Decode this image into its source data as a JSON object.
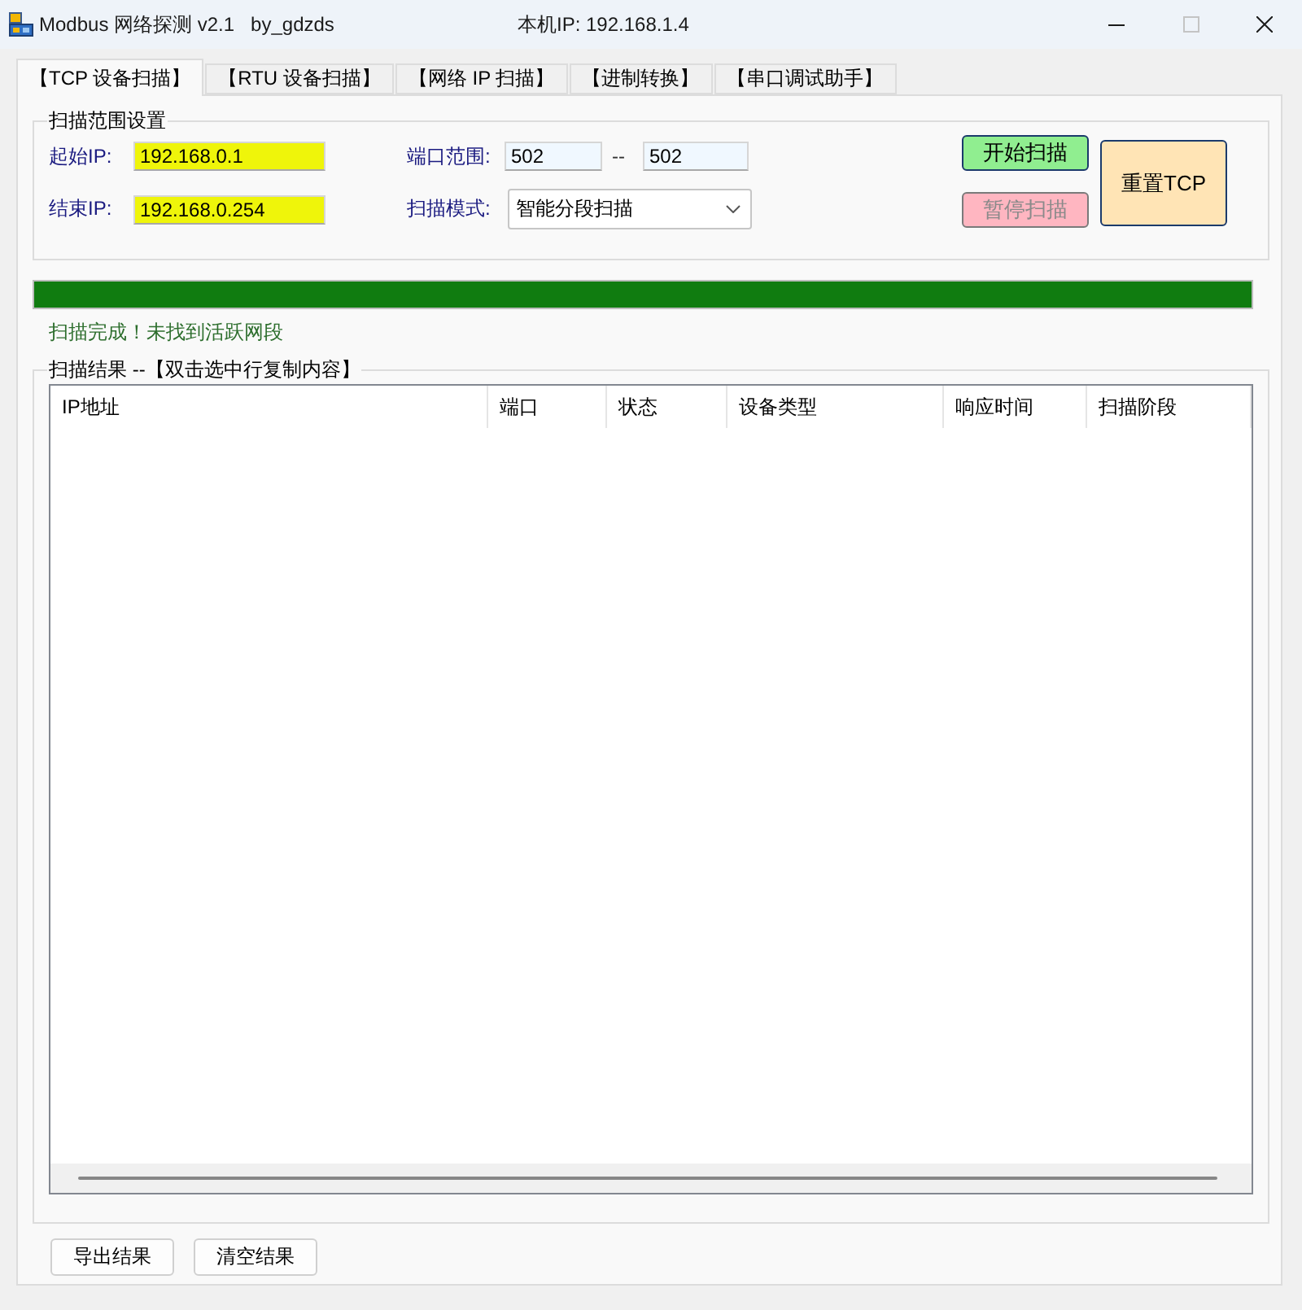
{
  "window": {
    "title": "Modbus 网络探测 v2.1   by_gdzds",
    "local_ip": "本机IP: 192.168.1.4",
    "maximize_disabled": true
  },
  "tabs": [
    {
      "label": "【TCP 设备扫描】",
      "selected": true
    },
    {
      "label": "【RTU 设备扫描】",
      "selected": false
    },
    {
      "label": "【网络 IP 扫描】",
      "selected": false
    },
    {
      "label": "【进制转换】",
      "selected": false
    },
    {
      "label": "【串口调试助手】",
      "selected": false
    }
  ],
  "scan_range": {
    "title": "扫描范围设置",
    "start_ip": {
      "label": "起始IP:",
      "value": "192.168.0.1"
    },
    "end_ip": {
      "label": "结束IP:",
      "value": "192.168.0.254"
    },
    "port_range": {
      "label": "端口范围:",
      "from": "502",
      "separator": "--",
      "to": "502"
    },
    "scan_mode": {
      "label": "扫描模式:",
      "value": "智能分段扫描"
    },
    "buttons": [
      {
        "kind": "start",
        "label": "开始扫描",
        "disabled": false
      },
      {
        "kind": "pause",
        "label": "暂停扫描",
        "disabled": true
      },
      {
        "kind": "reset",
        "label": "重置TCP",
        "disabled": false
      }
    ]
  },
  "progress": {
    "level": 1
  },
  "status": "扫描完成！未找到活跃网段",
  "results": {
    "title": "扫描结果 --【双击选中行复制内容】",
    "columns": [
      "IP地址",
      "端口",
      "状态",
      "设备类型",
      "响应时间",
      "扫描阶段"
    ]
  },
  "actions": [
    "导出结果",
    "清空结果"
  ]
}
